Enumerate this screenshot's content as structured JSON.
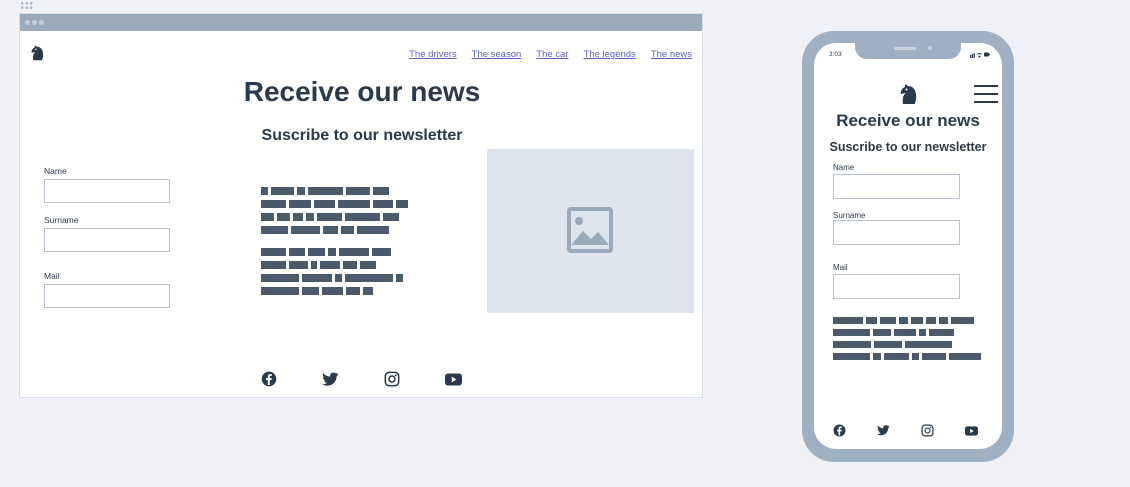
{
  "colors": {
    "page_background": "#eff1f6",
    "browser_bar": "#9aaabb",
    "text_dark": "#2b3a4a",
    "link": "#5f61c7",
    "text_placeholder_block": "#4a5a6b",
    "image_placeholder": "#dee4ed",
    "phone_frame": "#9fb0c3"
  },
  "desktop": {
    "nav": {
      "items": [
        "The drivers",
        "The season",
        "The car",
        "The legends",
        "The news"
      ]
    },
    "title": "Receive our news",
    "subtitle": "Suscribe to our newsletter",
    "form": {
      "name_label": "Name",
      "surname_label": "Surname",
      "mail_label": "Mail",
      "name_value": "",
      "surname_value": "",
      "mail_value": ""
    },
    "icons": {
      "logo": "horse-logo-icon",
      "image": "image-placeholder-icon",
      "social": [
        "facebook-icon",
        "twitter-icon",
        "instagram-icon",
        "youtube-icon"
      ]
    }
  },
  "mobile": {
    "status": {
      "time": "3:03"
    },
    "title": "Receive our news",
    "subtitle": "Suscribe to our newsletter",
    "form": {
      "name_label": "Name",
      "surname_label": "Surname",
      "mail_label": "Mail",
      "name_value": "",
      "surname_value": "",
      "mail_value": ""
    },
    "icons": {
      "logo": "horse-logo-icon",
      "menu": "hamburger-menu-icon",
      "social": [
        "facebook-icon",
        "twitter-icon",
        "instagram-icon",
        "youtube-icon"
      ]
    }
  }
}
